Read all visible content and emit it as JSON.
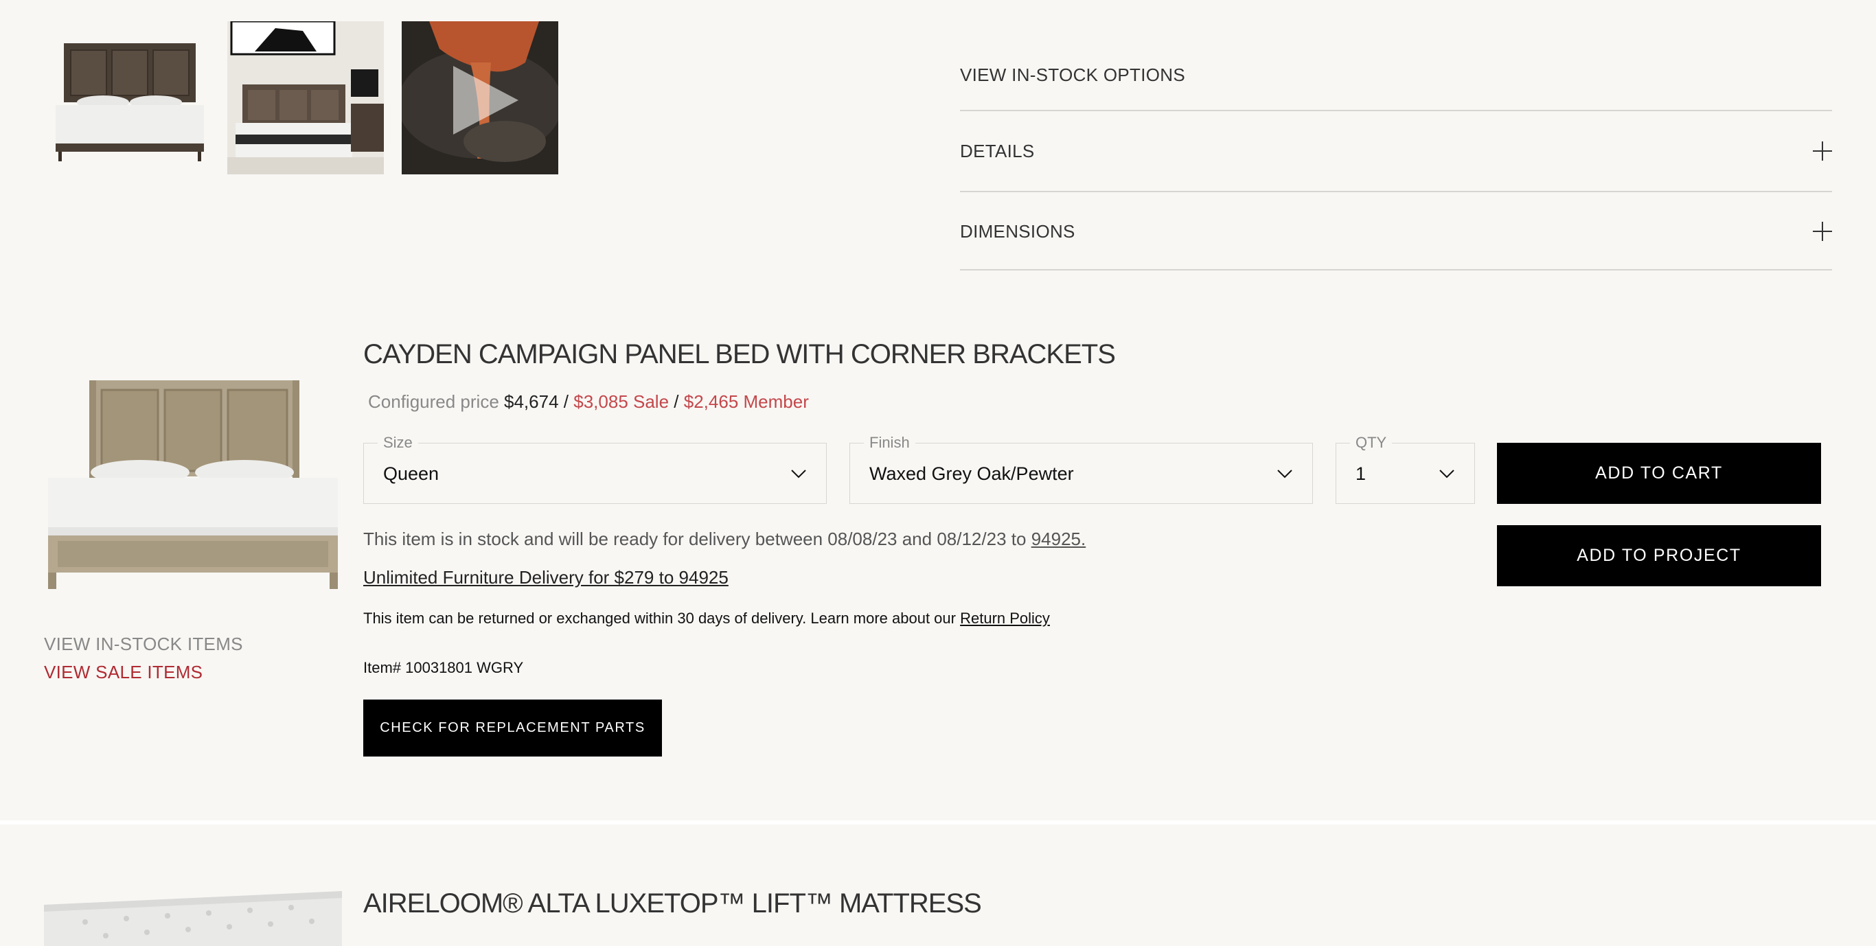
{
  "gallery": {
    "thumbnails": [
      {
        "name": "bed-front-thumbnail"
      },
      {
        "name": "bedroom-scene-thumbnail"
      },
      {
        "name": "video-thumbnail",
        "icon": "play-icon"
      }
    ]
  },
  "accordion": {
    "in_stock_link": "VIEW IN-STOCK OPTIONS",
    "sections": [
      {
        "label": "DETAILS",
        "icon": "plus-icon"
      },
      {
        "label": "DIMENSIONS",
        "icon": "plus-icon"
      }
    ]
  },
  "product": {
    "title": "CAYDEN CAMPAIGN PANEL BED WITH CORNER BRACKETS",
    "price_label": "Configured price",
    "price_regular": "$4,674",
    "price_sale": "$3,085 Sale",
    "price_member": "$2,465 Member",
    "separator": "/",
    "side_links": {
      "in_stock": "VIEW IN-STOCK ITEMS",
      "sale": "VIEW SALE ITEMS"
    },
    "size": {
      "label": "Size",
      "value": "Queen"
    },
    "finish": {
      "label": "Finish",
      "value": "Waxed Grey Oak/Pewter"
    },
    "qty": {
      "label": "QTY",
      "value": "1"
    },
    "add_to_cart": "ADD TO CART",
    "add_to_project": "ADD TO PROJECT",
    "stock_message": "This item is in stock and will be ready for delivery between 08/08/23 and 08/12/23 to",
    "stock_zip": "94925.",
    "delivery_link": "Unlimited Furniture Delivery for $279 to 94925",
    "return_text": "This item can be returned or exchanged within 30 days of delivery.  Learn more about our",
    "return_link": "Return Policy",
    "item_number": "Item# 10031801 WGRY",
    "replacement_parts": "CHECK FOR REPLACEMENT PARTS"
  },
  "next_product": {
    "title": "AIRELOOM® ALTA LUXETOP™ LIFT™ MATTRESS"
  },
  "colors": {
    "background": "#f8f7f4",
    "sale_red": "#c4474b",
    "link_red": "#b02b33",
    "button_black": "#000000"
  }
}
